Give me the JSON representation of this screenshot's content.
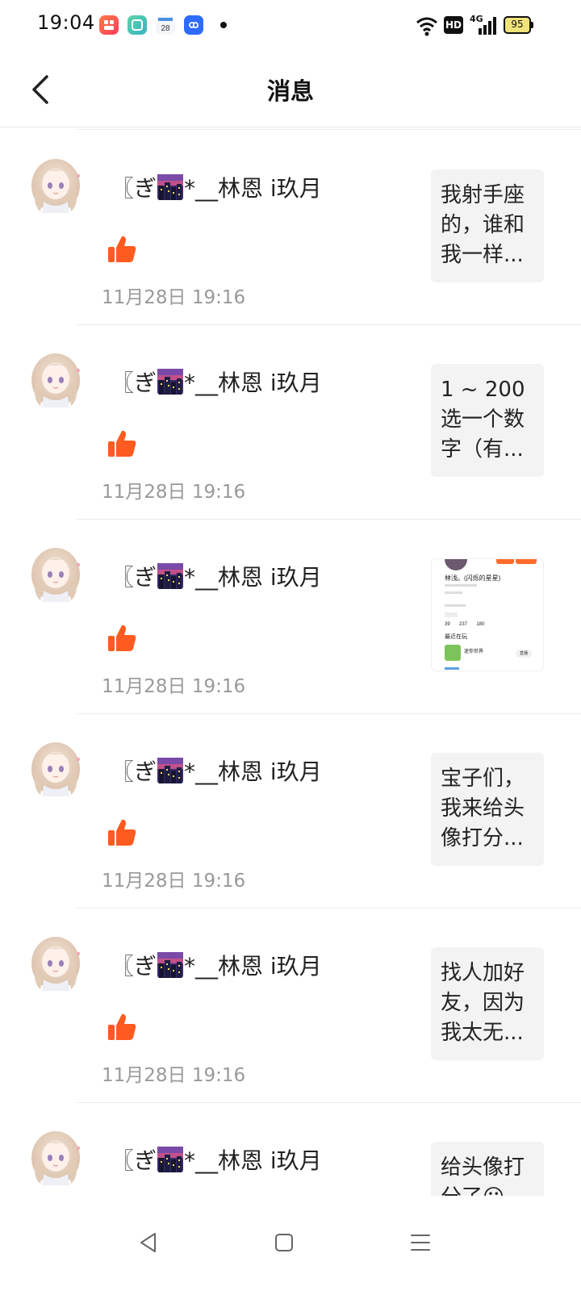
{
  "status_bar": {
    "time": "19:04",
    "calendar_day": "28",
    "battery": "95",
    "network": "4G",
    "hd": "HD"
  },
  "header": {
    "title": "消息"
  },
  "messages": [
    {
      "username_prefix": "〖ぎ",
      "username_suffix": "*__林恩 i玖月",
      "time": "11月28日 19:16",
      "preview_text": "我射手座的，谁和我一样..."
    },
    {
      "username_prefix": "〖ぎ",
      "username_suffix": "*__林恩 i玖月",
      "time": "11月28日 19:16",
      "preview_text": "1 ~ 200 选一个数字（有..."
    },
    {
      "username_prefix": "〖ぎ",
      "username_suffix": "*__林恩 i玖月",
      "time": "11月28日 19:16",
      "preview_text": "",
      "preview_image": {
        "name": "林浅。(闪烁的星星)",
        "stat1": "39",
        "stat2": "237",
        "stat3": "180",
        "section": "最近在玩",
        "game": "迷你世界",
        "button": "直播"
      }
    },
    {
      "username_prefix": "〖ぎ",
      "username_suffix": "*__林恩 i玖月",
      "time": "11月28日 19:16",
      "preview_text": "宝子们，我来给头像打分..."
    },
    {
      "username_prefix": "〖ぎ",
      "username_suffix": "*__林恩 i玖月",
      "time": "11月28日 19:16",
      "preview_text": "找人加好友，因为我太无..."
    },
    {
      "username_prefix": "〖ぎ",
      "username_suffix": "*__林恩 i玖月",
      "time": "",
      "preview_text": "给头像打分了😃"
    }
  ],
  "colors": {
    "like": "#ff5a1f",
    "time": "#999999",
    "preview_bg": "#f3f3f3"
  }
}
